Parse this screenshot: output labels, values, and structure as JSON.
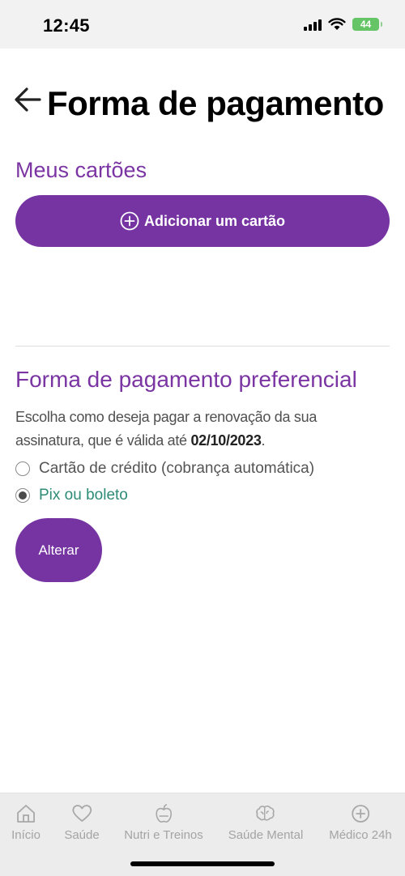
{
  "status_bar": {
    "time": "12:45",
    "battery": "44"
  },
  "header": {
    "title": "Forma de pagamento"
  },
  "cards": {
    "title": "Meus cartões",
    "add_button": "Adicionar um cartão"
  },
  "preferred": {
    "title": "Forma de pagamento preferencial",
    "description_prefix": "Escolha como deseja pagar a renovação da sua assinatura, que é válida até ",
    "valid_until": "02/10/2023",
    "description_suffix": ".",
    "options": [
      {
        "label": "Cartão de crédito (cobrança automática)",
        "selected": false
      },
      {
        "label": "Pix ou boleto",
        "selected": true
      }
    ],
    "change_button": "Alterar"
  },
  "bottom_nav": {
    "items": [
      {
        "label": "Início",
        "icon": "home-icon"
      },
      {
        "label": "Saúde",
        "icon": "heart-icon"
      },
      {
        "label": "Nutri e Treinos",
        "icon": "apple-icon"
      },
      {
        "label": "Saúde Mental",
        "icon": "brain-icon"
      },
      {
        "label": "Médico 24h",
        "icon": "medical-plus-icon"
      }
    ]
  },
  "colors": {
    "accent": "#7634a2",
    "title_purple": "#7b35a3",
    "selected_text": "#2e8b76"
  }
}
